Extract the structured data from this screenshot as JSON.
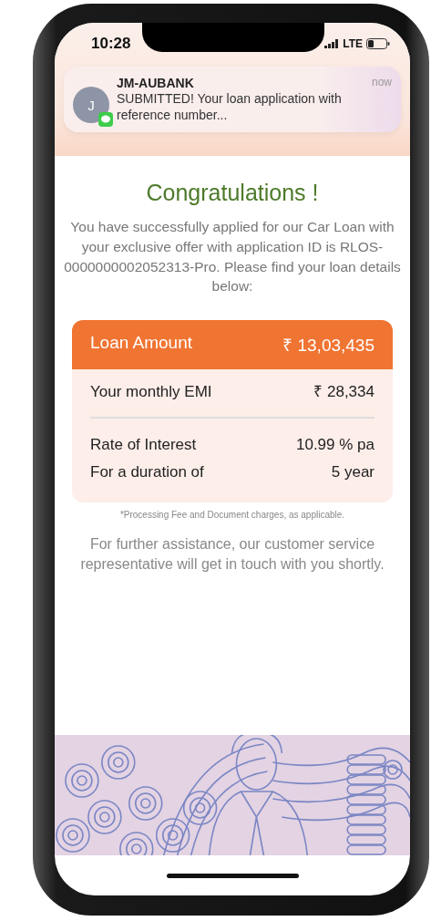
{
  "status_bar": {
    "time": "10:28",
    "network": "LTE"
  },
  "notification": {
    "avatar_letter": "J",
    "sender": "JM-AUBANK",
    "time": "now",
    "message": "SUBMITTED! Your loan application with reference number..."
  },
  "title": "Congratulations !",
  "intro": "You have successfully applied for our Car Loan with your exclusive offer with application ID is RLOS-0000000002052313-Pro. Please find your loan details below:",
  "loan_amount": {
    "label": "Loan Amount",
    "value": "₹ 13,03,435"
  },
  "emi_rows": [
    {
      "label": "Your monthly EMI",
      "value": "₹ 28,334"
    }
  ],
  "rate_rows": [
    {
      "label": "Rate of Interest",
      "value": "10.99 % pa"
    },
    {
      "label": "For a duration of",
      "value": "5 year"
    }
  ],
  "footnote": "*Processing Fee and Document charges, as applicable.",
  "assistance": "For further assistance, our customer service representative will get in touch with you shortly."
}
